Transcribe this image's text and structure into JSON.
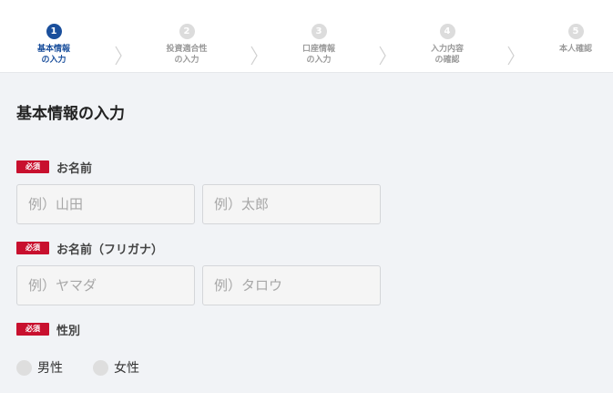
{
  "steps": [
    {
      "number": "1",
      "label": "基本情報\nの入力",
      "active": true
    },
    {
      "number": "2",
      "label": "投資適合性\nの入力",
      "active": false
    },
    {
      "number": "3",
      "label": "口座情報\nの入力",
      "active": false
    },
    {
      "number": "4",
      "label": "入力内容\nの確認",
      "active": false
    },
    {
      "number": "5",
      "label": "本人確認",
      "active": false
    }
  ],
  "page_title": "基本情報の入力",
  "required_badge": "必須",
  "fields": {
    "name": {
      "label": "お名前",
      "last_placeholder": "例）山田",
      "first_placeholder": "例）太郎"
    },
    "name_kana": {
      "label": "お名前（フリガナ）",
      "last_placeholder": "例）ヤマダ",
      "first_placeholder": "例）タロウ"
    },
    "gender": {
      "label": "性別",
      "options": [
        "男性",
        "女性"
      ]
    }
  },
  "colors": {
    "accent": "#1a4f9c",
    "required": "#c8102e",
    "background": "#f1f3f6"
  }
}
